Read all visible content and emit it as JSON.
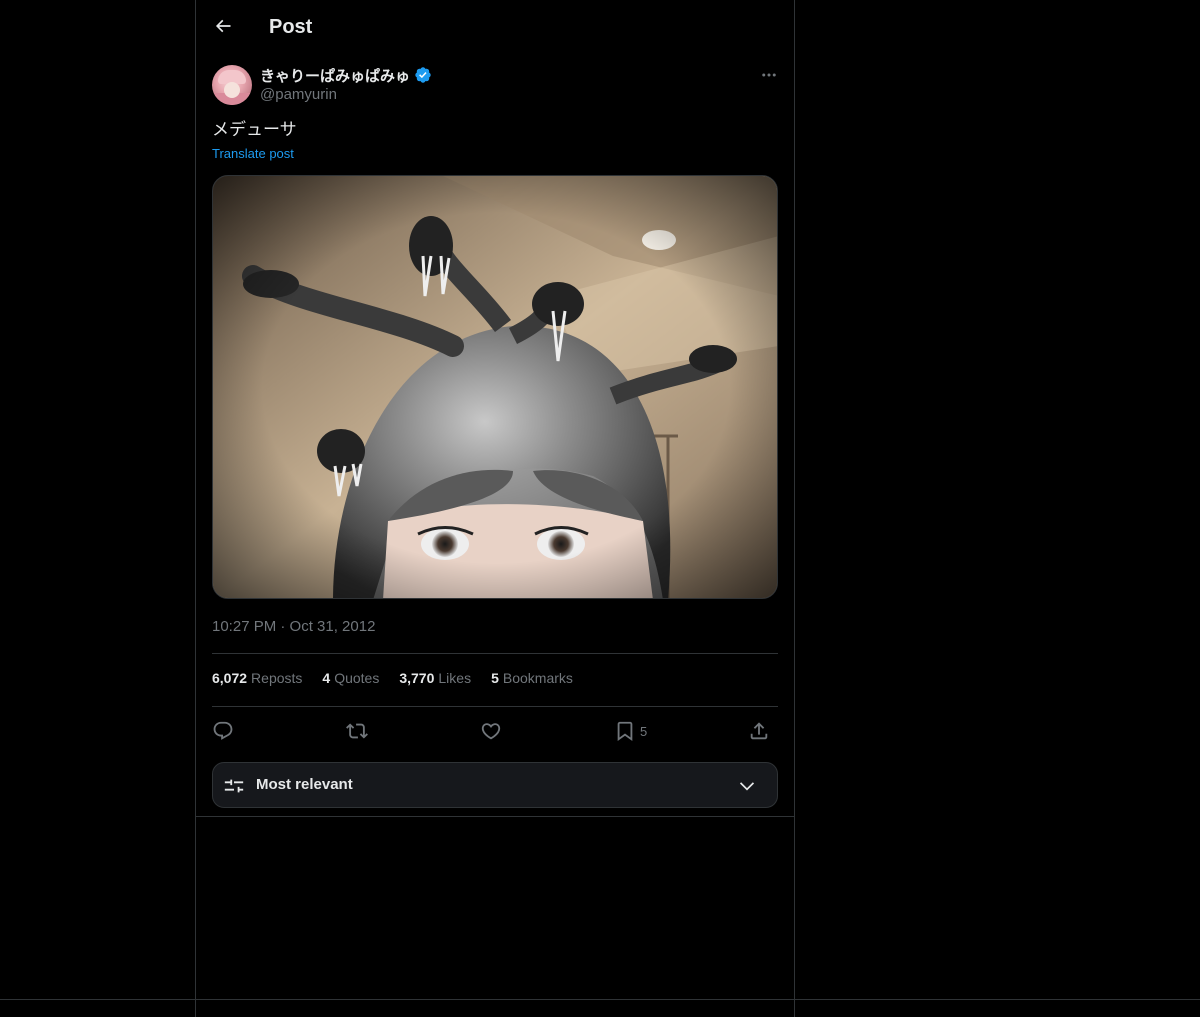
{
  "header": {
    "title": "Post",
    "back_icon": "arrow-left-icon"
  },
  "author": {
    "display_name": "きゃりーぱみゅぱみゅ",
    "handle": "@pamyurin",
    "verified": true,
    "verified_color": "#1d9bf0"
  },
  "post": {
    "text": "メデューサ",
    "translate_label": "Translate post",
    "timestamp": "10:27 PM · Oct 31, 2012"
  },
  "stats": [
    {
      "count": "6,072",
      "label": "Reposts"
    },
    {
      "count": "4",
      "label": "Quotes"
    },
    {
      "count": "3,770",
      "label": "Likes"
    },
    {
      "count": "5",
      "label": "Bookmarks"
    }
  ],
  "actions": {
    "reply_icon": "reply-icon",
    "repost_icon": "repost-icon",
    "like_icon": "heart-icon",
    "bookmark_icon": "bookmark-icon",
    "bookmark_count": "5",
    "share_icon": "share-icon"
  },
  "sort": {
    "label": "Most relevant"
  },
  "colors": {
    "background": "#000000",
    "border": "#2f3336",
    "text_primary": "#e7e9ea",
    "text_secondary": "#71767b",
    "accent": "#1d9bf0"
  }
}
